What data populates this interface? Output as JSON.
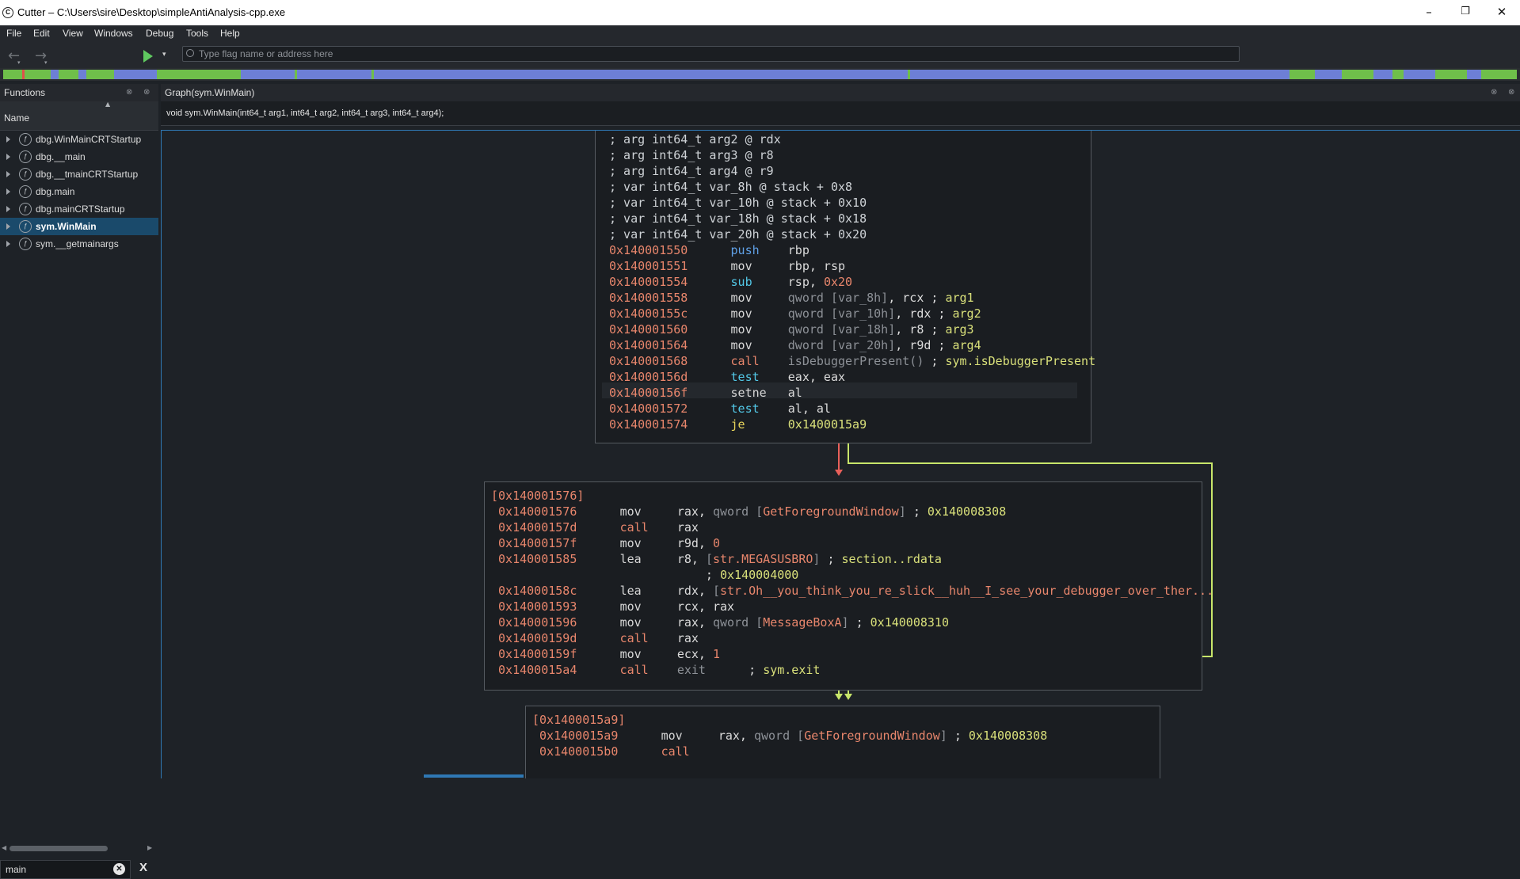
{
  "window": {
    "title": "Cutter – C:\\Users\\sire\\Desktop\\simpleAntiAnalysis-cpp.exe",
    "app_icon_glyph": "C",
    "minimize_glyph": "–",
    "maximize_glyph": "❐",
    "close_glyph": "✕"
  },
  "menu": [
    "File",
    "Edit",
    "View",
    "Windows",
    "Debug",
    "Tools",
    "Help"
  ],
  "toolbar": {
    "back_glyph": "←",
    "forward_glyph": "→",
    "dropdown_glyph": "▾",
    "search_placeholder": "Type flag name or address here"
  },
  "functions_panel": {
    "title": "Functions",
    "column_header": "Name",
    "sort_glyph": "▲",
    "filter_value": "main",
    "filter_clear_glyph": "✕",
    "close_glyph": "X",
    "items": [
      {
        "name": "dbg.WinMainCRTStartup",
        "selected": false
      },
      {
        "name": "dbg.__main",
        "selected": false
      },
      {
        "name": "dbg.__tmainCRTStartup",
        "selected": false
      },
      {
        "name": "dbg.main",
        "selected": false
      },
      {
        "name": "dbg.mainCRTStartup",
        "selected": false
      },
      {
        "name": "sym.WinMain",
        "selected": true
      },
      {
        "name": "sym.__getmainargs",
        "selected": false
      }
    ]
  },
  "graph_panel": {
    "title": "Graph(sym.WinMain)",
    "signature": "void sym.WinMain(int64_t arg1, int64_t arg2, int64_t arg3, int64_t arg4);",
    "blocks": [
      {
        "id": "entry",
        "lines": [
          [
            {
              "t": "; arg int64_t arg2 @ rdx",
              "c": "c-com"
            }
          ],
          [
            {
              "t": "; arg int64_t arg3 @ r8",
              "c": "c-com"
            }
          ],
          [
            {
              "t": "; arg int64_t arg4 @ r9",
              "c": "c-com"
            }
          ],
          [
            {
              "t": "; var int64_t var_8h @ stack + 0x8",
              "c": "c-com"
            }
          ],
          [
            {
              "t": "; var int64_t var_10h @ stack + 0x10",
              "c": "c-com"
            }
          ],
          [
            {
              "t": "; var int64_t var_18h @ stack + 0x18",
              "c": "c-com"
            }
          ],
          [
            {
              "t": "; var int64_t var_20h @ stack + 0x20",
              "c": "c-com"
            }
          ],
          [
            {
              "t": "0x140001550",
              "c": "c-addr"
            },
            {
              "t": "      "
            },
            {
              "t": "push",
              "c": "c-op-push"
            },
            {
              "t": "    "
            },
            {
              "t": "rbp",
              "c": "c-reg"
            }
          ],
          [
            {
              "t": "0x140001551",
              "c": "c-addr"
            },
            {
              "t": "      "
            },
            {
              "t": "mov",
              "c": "c-op"
            },
            {
              "t": "     "
            },
            {
              "t": "rbp, rsp",
              "c": "c-reg"
            }
          ],
          [
            {
              "t": "0x140001554",
              "c": "c-addr"
            },
            {
              "t": "      "
            },
            {
              "t": "sub",
              "c": "c-op-sub"
            },
            {
              "t": "     "
            },
            {
              "t": "rsp, ",
              "c": "c-reg"
            },
            {
              "t": "0x20",
              "c": "c-num"
            }
          ],
          [
            {
              "t": "0x140001558",
              "c": "c-addr"
            },
            {
              "t": "      "
            },
            {
              "t": "mov",
              "c": "c-op"
            },
            {
              "t": "     "
            },
            {
              "t": "qword [var_8h]",
              "c": "c-dim"
            },
            {
              "t": ", rcx ; ",
              "c": "c-reg"
            },
            {
              "t": "arg1",
              "c": "c-ann"
            }
          ],
          [
            {
              "t": "0x14000155c",
              "c": "c-addr"
            },
            {
              "t": "      "
            },
            {
              "t": "mov",
              "c": "c-op"
            },
            {
              "t": "     "
            },
            {
              "t": "qword [var_10h]",
              "c": "c-dim"
            },
            {
              "t": ", rdx ; ",
              "c": "c-reg"
            },
            {
              "t": "arg2",
              "c": "c-ann"
            }
          ],
          [
            {
              "t": "0x140001560",
              "c": "c-addr"
            },
            {
              "t": "      "
            },
            {
              "t": "mov",
              "c": "c-op"
            },
            {
              "t": "     "
            },
            {
              "t": "qword [var_18h]",
              "c": "c-dim"
            },
            {
              "t": ", r8 ; ",
              "c": "c-reg"
            },
            {
              "t": "arg3",
              "c": "c-ann"
            }
          ],
          [
            {
              "t": "0x140001564",
              "c": "c-addr"
            },
            {
              "t": "      "
            },
            {
              "t": "mov",
              "c": "c-op"
            },
            {
              "t": "     "
            },
            {
              "t": "dword [var_20h]",
              "c": "c-dim"
            },
            {
              "t": ", r9d ; ",
              "c": "c-reg"
            },
            {
              "t": "arg4",
              "c": "c-ann"
            }
          ],
          [
            {
              "t": "0x140001568",
              "c": "c-addr"
            },
            {
              "t": "      "
            },
            {
              "t": "call",
              "c": "c-op-call"
            },
            {
              "t": "    "
            },
            {
              "t": "isDebuggerPresent()",
              "c": "c-dim"
            },
            {
              "t": " ; ",
              "c": "c-reg"
            },
            {
              "t": "sym.isDebuggerPresent",
              "c": "c-ann"
            }
          ],
          [
            {
              "t": "0x14000156d",
              "c": "c-addr"
            },
            {
              "t": "      "
            },
            {
              "t": "test",
              "c": "c-op-test"
            },
            {
              "t": "    "
            },
            {
              "t": "eax, eax",
              "c": "c-reg"
            }
          ],
          [
            {
              "t": "0x14000156f",
              "c": "c-addr"
            },
            {
              "t": "      "
            },
            {
              "t": "setne",
              "c": "c-op"
            },
            {
              "t": "   "
            },
            {
              "t": "al",
              "c": "c-reg"
            }
          ],
          [
            {
              "t": "0x140001572",
              "c": "c-addr"
            },
            {
              "t": "      "
            },
            {
              "t": "test",
              "c": "c-op-test"
            },
            {
              "t": "    "
            },
            {
              "t": "al, al",
              "c": "c-reg"
            }
          ],
          [
            {
              "t": "0x140001574",
              "c": "c-addr"
            },
            {
              "t": "      "
            },
            {
              "t": "je",
              "c": "c-op-je"
            },
            {
              "t": "      "
            },
            {
              "t": "0x1400015a9",
              "c": "c-ann"
            }
          ]
        ]
      },
      {
        "id": "block_0x140001576",
        "lines": [
          [
            {
              "t": "[0x140001576]",
              "c": "c-lbl"
            }
          ],
          [
            {
              "t": " "
            },
            {
              "t": "0x140001576",
              "c": "c-addr"
            },
            {
              "t": "      "
            },
            {
              "t": "mov",
              "c": "c-op"
            },
            {
              "t": "     "
            },
            {
              "t": "rax, ",
              "c": "c-reg"
            },
            {
              "t": "qword [",
              "c": "c-dim"
            },
            {
              "t": "GetForegroundWindow",
              "c": "c-str"
            },
            {
              "t": "]",
              "c": "c-dim"
            },
            {
              "t": " ; ",
              "c": "c-reg"
            },
            {
              "t": "0x140008308",
              "c": "c-ann"
            }
          ],
          [
            {
              "t": " "
            },
            {
              "t": "0x14000157d",
              "c": "c-addr"
            },
            {
              "t": "      "
            },
            {
              "t": "call",
              "c": "c-op-call"
            },
            {
              "t": "    "
            },
            {
              "t": "rax",
              "c": "c-reg"
            }
          ],
          [
            {
              "t": " "
            },
            {
              "t": "0x14000157f",
              "c": "c-addr"
            },
            {
              "t": "      "
            },
            {
              "t": "mov",
              "c": "c-op"
            },
            {
              "t": "     "
            },
            {
              "t": "r9d, ",
              "c": "c-reg"
            },
            {
              "t": "0",
              "c": "c-num"
            }
          ],
          [
            {
              "t": " "
            },
            {
              "t": "0x140001585",
              "c": "c-addr"
            },
            {
              "t": "      "
            },
            {
              "t": "lea",
              "c": "c-op"
            },
            {
              "t": "     "
            },
            {
              "t": "r8, ",
              "c": "c-reg"
            },
            {
              "t": "[",
              "c": "c-dim"
            },
            {
              "t": "str.MEGASUSBRO",
              "c": "c-str"
            },
            {
              "t": "]",
              "c": "c-dim"
            },
            {
              "t": " ; ",
              "c": "c-reg"
            },
            {
              "t": "section..rdata",
              "c": "c-ann"
            }
          ],
          [
            {
              "t": "                              ; ",
              "c": "c-reg"
            },
            {
              "t": "0x140004000",
              "c": "c-ann"
            }
          ],
          [
            {
              "t": " "
            },
            {
              "t": "0x14000158c",
              "c": "c-addr"
            },
            {
              "t": "      "
            },
            {
              "t": "lea",
              "c": "c-op"
            },
            {
              "t": "     "
            },
            {
              "t": "rdx, ",
              "c": "c-reg"
            },
            {
              "t": "[",
              "c": "c-dim"
            },
            {
              "t": "str.Oh__you_think_you_re_slick__huh__I_see_your_debugger_over_ther...",
              "c": "c-str"
            }
          ],
          [
            {
              "t": " "
            },
            {
              "t": "0x140001593",
              "c": "c-addr"
            },
            {
              "t": "      "
            },
            {
              "t": "mov",
              "c": "c-op"
            },
            {
              "t": "     "
            },
            {
              "t": "rcx, rax",
              "c": "c-reg"
            }
          ],
          [
            {
              "t": " "
            },
            {
              "t": "0x140001596",
              "c": "c-addr"
            },
            {
              "t": "      "
            },
            {
              "t": "mov",
              "c": "c-op"
            },
            {
              "t": "     "
            },
            {
              "t": "rax, ",
              "c": "c-reg"
            },
            {
              "t": "qword [",
              "c": "c-dim"
            },
            {
              "t": "MessageBoxA",
              "c": "c-str"
            },
            {
              "t": "]",
              "c": "c-dim"
            },
            {
              "t": " ; ",
              "c": "c-reg"
            },
            {
              "t": "0x140008310",
              "c": "c-ann"
            }
          ],
          [
            {
              "t": " "
            },
            {
              "t": "0x14000159d",
              "c": "c-addr"
            },
            {
              "t": "      "
            },
            {
              "t": "call",
              "c": "c-op-call"
            },
            {
              "t": "    "
            },
            {
              "t": "rax",
              "c": "c-reg"
            }
          ],
          [
            {
              "t": " "
            },
            {
              "t": "0x14000159f",
              "c": "c-addr"
            },
            {
              "t": "      "
            },
            {
              "t": "mov",
              "c": "c-op"
            },
            {
              "t": "     "
            },
            {
              "t": "ecx, ",
              "c": "c-reg"
            },
            {
              "t": "1",
              "c": "c-num"
            }
          ],
          [
            {
              "t": " "
            },
            {
              "t": "0x1400015a4",
              "c": "c-addr"
            },
            {
              "t": "      "
            },
            {
              "t": "call",
              "c": "c-op-call"
            },
            {
              "t": "    "
            },
            {
              "t": "exit",
              "c": "c-dim"
            },
            {
              "t": "      ; ",
              "c": "c-reg"
            },
            {
              "t": "sym.exit",
              "c": "c-ann"
            }
          ]
        ]
      },
      {
        "id": "block_0x1400015a9",
        "lines": [
          [
            {
              "t": "[0x1400015a9]",
              "c": "c-lbl"
            }
          ],
          [
            {
              "t": " "
            },
            {
              "t": "0x1400015a9",
              "c": "c-addr"
            },
            {
              "t": "      "
            },
            {
              "t": "mov",
              "c": "c-op"
            },
            {
              "t": "     "
            },
            {
              "t": "rax, ",
              "c": "c-reg"
            },
            {
              "t": "qword [",
              "c": "c-dim"
            },
            {
              "t": "GetForegroundWindow",
              "c": "c-str"
            },
            {
              "t": "]",
              "c": "c-dim"
            },
            {
              "t": " ; ",
              "c": "c-reg"
            },
            {
              "t": "0x140008308",
              "c": "c-ann"
            }
          ],
          [
            {
              "t": " "
            },
            {
              "t": "0x1400015b0",
              "c": "c-addr"
            },
            {
              "t": "      "
            },
            {
              "t": "call",
              "c": "c-op-call"
            }
          ]
        ]
      }
    ]
  },
  "colors": {
    "accent": "#2f78b4",
    "map_green": "#6fbf4a",
    "map_blue": "#6d7fd6",
    "map_red": "#e0504a",
    "edge_false": "#e8605a",
    "edge_true": "#c8e66a"
  },
  "icons": {
    "app": "cutter-logo-icon",
    "back": "arrow-left-icon",
    "forward": "arrow-right-icon",
    "play": "play-icon",
    "search": "search-icon",
    "function": "function-icon",
    "expand": "triangle-right-icon"
  }
}
